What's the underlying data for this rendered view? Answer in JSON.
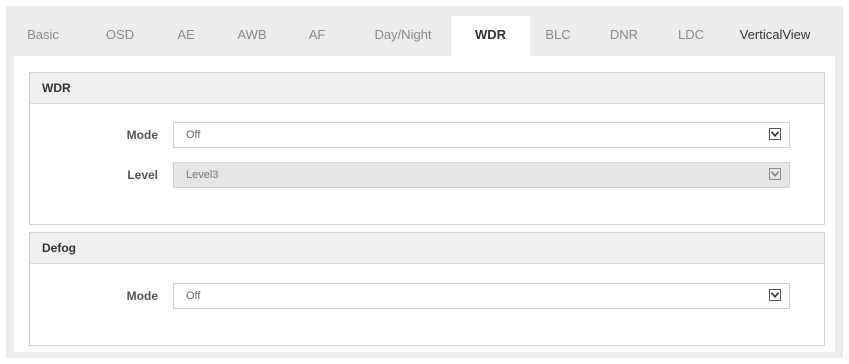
{
  "tabs": [
    {
      "label": "Basic",
      "active": false
    },
    {
      "label": "OSD",
      "active": false
    },
    {
      "label": "AE",
      "active": false
    },
    {
      "label": "AWB",
      "active": false
    },
    {
      "label": "AF",
      "active": false
    },
    {
      "label": "Day/Night",
      "active": false
    },
    {
      "label": "WDR",
      "active": true
    },
    {
      "label": "BLC",
      "active": false
    },
    {
      "label": "DNR",
      "active": false
    },
    {
      "label": "LDC",
      "active": false
    },
    {
      "label": "VerticalView",
      "active": false
    }
  ],
  "wdr": {
    "title": "WDR",
    "mode_label": "Mode",
    "mode_value": "Off",
    "level_label": "Level",
    "level_value": "Level3",
    "level_disabled": true
  },
  "defog": {
    "title": "Defog",
    "mode_label": "Mode",
    "mode_value": "Off"
  },
  "icons": {
    "dropdown": "chevron-down-icon"
  }
}
